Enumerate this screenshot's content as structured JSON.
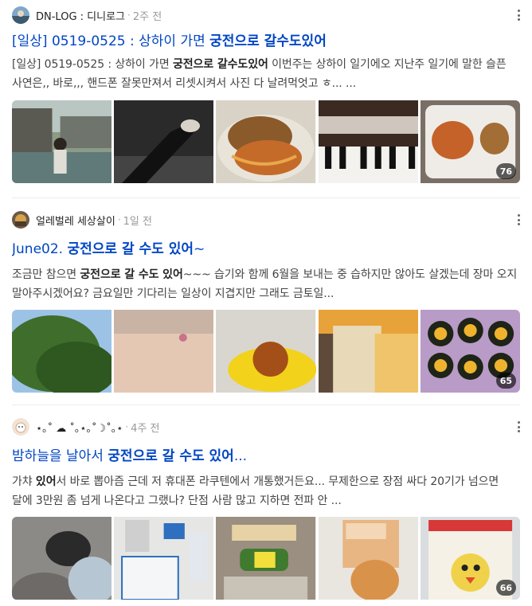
{
  "posts": [
    {
      "author": "DN-LOG : 디니로그",
      "time": "2주 전",
      "title_pre": "[일상] 0519-0525 : 상하이 가면 ",
      "title_hl": "궁전으로 갈수도있어",
      "title_post": "",
      "snip_a": "[일상] 0519-0525 : 상하이 가면 ",
      "snip_b": "궁전으로 갈수도있어",
      "snip_c": " 이번주는 상하이 일기에오 지난주 일기에 말한 슬픈 사연은,, 바로,,, 핸드폰 잘못만져서 리셋시켜서 사진 다 날려먹엇고 ㅎ... ...",
      "snip_d": "",
      "snip_e": "",
      "photo_count": "76",
      "photo_names": [
        "person-by-canal-photo",
        "legs-on-bed-photo",
        "fried-dish-photo",
        "piano-keys-photo",
        "food-plate-photo"
      ]
    },
    {
      "author": "얼레벌레 세상살이",
      "time": "1일 전",
      "title_pre": "June02. ",
      "title_hl": "궁전으로 갈 수도 있어",
      "title_post": "~",
      "snip_a": "조금만 참으면 ",
      "snip_b": "궁전으로 갈 수도 있어",
      "snip_c": "~~~ 습기와 함께 6월을 보내는 중 습하지만 않아도 살겠는데 장마 오지 말아주시겠어요? 금요일만 기다리는 일상이 지겹지만 그래도 금토일...",
      "snip_d": "",
      "snip_e": "",
      "photo_count": "65",
      "photo_names": [
        "tree-sky-photo",
        "skin-closeup-photo",
        "dessert-plate-photo",
        "iced-drink-photo",
        "kimbap-plate-photo"
      ]
    },
    {
      "author": "⋆｡˚ ☁︎ ˚｡⋆｡˚☽˚｡⋆",
      "time": "4주 전",
      "title_pre": "밤하늘을 날아서 ",
      "title_hl": "궁전으로 갈 수도 있어",
      "title_post": "...",
      "snip_a": "가챠 ",
      "snip_b": "있어",
      "snip_c": "서 바로 뽑아즘 근데 저 휴대폰 라쿠텐에서 개통했거든요... 무제한으로 장점 싸다 20기가 넘으면 달에 3만원 좀 넘게 나온다고 그랬나? 단점 사람 많고 지하면 전파 안 ...",
      "snip_d": "",
      "snip_e": "",
      "photo_count": "66",
      "photo_names": [
        "people-seated-photo",
        "store-items-photo",
        "bottles-bag-photo",
        "carton-box-photo",
        "snack-package-photo"
      ]
    }
  ],
  "colors": {
    "title": "#0046c4",
    "text": "#444444",
    "meta": "#999999"
  }
}
